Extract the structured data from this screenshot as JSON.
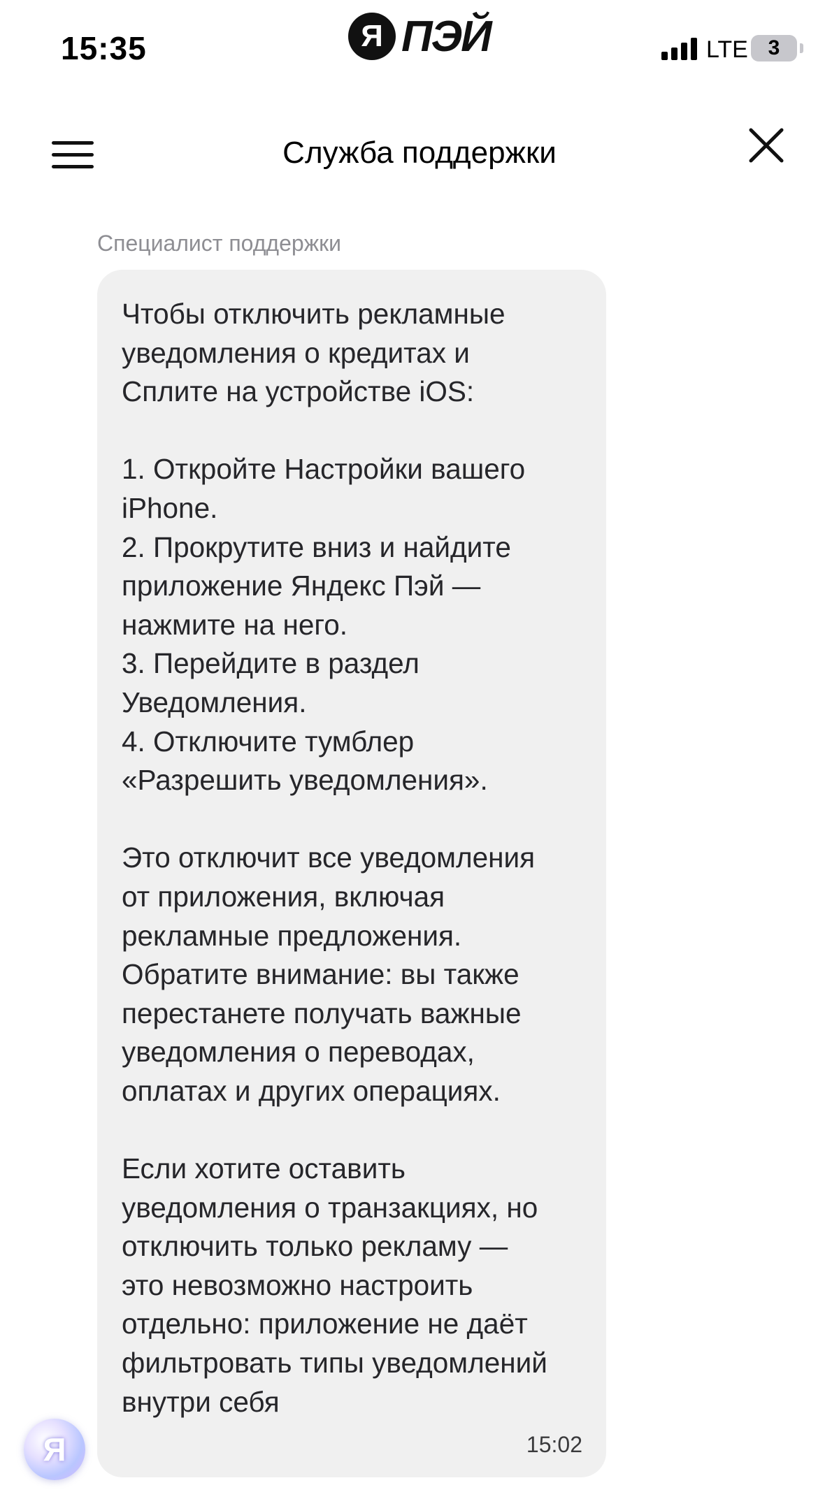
{
  "status_bar": {
    "time": "15:35",
    "network": "LTE",
    "battery": "3",
    "brand": {
      "letter": "Я",
      "name": "ПЭЙ"
    }
  },
  "header": {
    "title": "Служба поддержки"
  },
  "chat": {
    "messages": [
      {
        "sender": "Специалист поддержки",
        "text": "Чтобы отключить рекламные\nуведомления о кредитах и\nСплите на устройстве iOS:\n\n1. Откройте Настройки вашего\niPhone.\n2. Прокрутите вниз и найдите\nприложение Яндекс Пэй —\nнажмите на него.\n3. Перейдите в раздел\nУведомления.\n4. Отключите тумблер\n«Разрешить уведомления».\n\nЭто отключит все уведомления\nот приложения, включая\nрекламные предложения.\nОбратите внимание: вы также\nперестанете получать важные\nуведомления о переводах,\nоплатах и других операциях.\n\nЕсли хотите оставить\nуведомления о транзакциях, но\nотключить только рекламу —\nэто невозможно настроить\nотдельно: приложение не даёт\nфильтровать типы уведомлений\nвнутри себя",
        "time": "15:02"
      }
    ]
  },
  "assistant": {
    "letter": "Я"
  },
  "icons": {
    "menu": "menu-icon",
    "close": "close-icon",
    "signal": "signal-icon",
    "battery": "battery-icon"
  },
  "colors": {
    "bubble_bg": "#f0f0f0",
    "secondary_text": "#8e8e93"
  }
}
